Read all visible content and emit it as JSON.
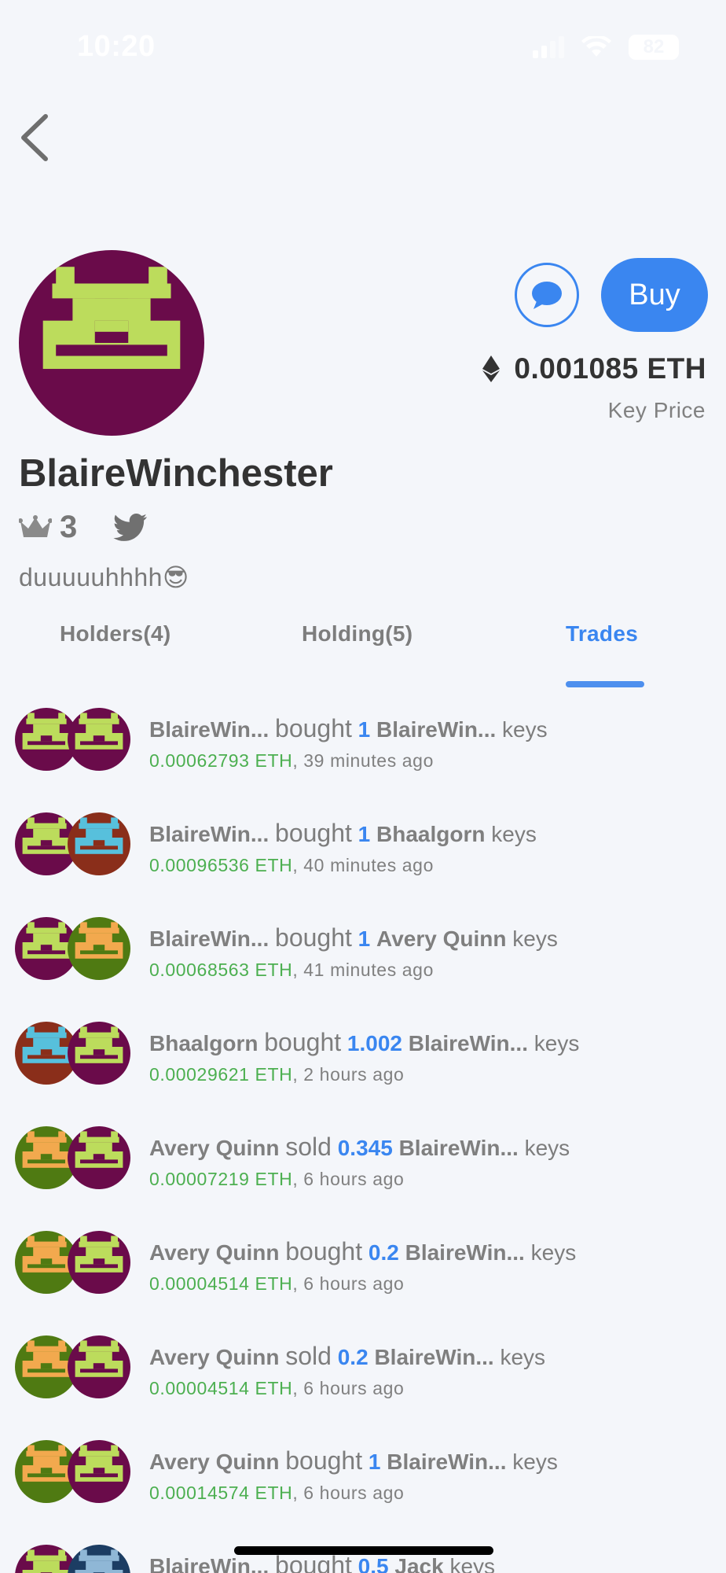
{
  "status": {
    "time": "10:20",
    "battery": "82"
  },
  "profile": {
    "name": "BlaireWinchester",
    "rank": "3",
    "bio": "duuuuuhhhh😎",
    "price": "0.001085 ETH",
    "price_caption": "Key Price",
    "buy_label": "Buy"
  },
  "tabs": [
    {
      "label": "Holders(4)"
    },
    {
      "label": "Holding(5)"
    },
    {
      "label": "Trades"
    }
  ],
  "trades": [
    {
      "trader": "BlaireWin...",
      "action": "bought",
      "amount": "1",
      "subject": "BlaireWin...",
      "unit": "keys",
      "eth": "0.00062793 ETH",
      "time": ", 39 minutes ago"
    },
    {
      "trader": "BlaireWin...",
      "action": "bought",
      "amount": "1",
      "subject": "Bhaalgorn",
      "unit": "keys",
      "eth": "0.00096536 ETH",
      "time": ", 40 minutes ago"
    },
    {
      "trader": "BlaireWin...",
      "action": "bought",
      "amount": "1",
      "subject": "Avery Quinn",
      "unit": "keys",
      "eth": "0.00068563 ETH",
      "time": ", 41 minutes ago"
    },
    {
      "trader": "Bhaalgorn",
      "action": "bought",
      "amount": "1.002",
      "subject": "BlaireWin...",
      "unit": "keys",
      "eth": "0.00029621 ETH",
      "time": ", 2 hours ago"
    },
    {
      "trader": "Avery Quinn",
      "action": "sold",
      "amount": "0.345",
      "subject": "BlaireWin...",
      "unit": "keys",
      "eth": "0.00007219 ETH",
      "time": ", 6 hours ago"
    },
    {
      "trader": "Avery Quinn",
      "action": "bought",
      "amount": "0.2",
      "subject": "BlaireWin...",
      "unit": "keys",
      "eth": "0.00004514 ETH",
      "time": ", 6 hours ago"
    },
    {
      "trader": "Avery Quinn",
      "action": "sold",
      "amount": "0.2",
      "subject": "BlaireWin...",
      "unit": "keys",
      "eth": "0.00004514 ETH",
      "time": ", 6 hours ago"
    },
    {
      "trader": "Avery Quinn",
      "action": "bought",
      "amount": "1",
      "subject": "BlaireWin...",
      "unit": "keys",
      "eth": "0.00014574 ETH",
      "time": ", 6 hours ago"
    },
    {
      "trader": "BlaireWin...",
      "action": "bought",
      "amount": "0.5",
      "subject": "Jack",
      "unit": "keys",
      "eth": "",
      "time": ""
    }
  ],
  "colors": {
    "accent": "#3a86f0",
    "eth_green": "#4caf50",
    "blaire_bg": "#6a0b4a",
    "blaire_fg": "#bcdc5c",
    "bhaal_bg": "#8a2e1a",
    "bhaal_fg": "#57c0dc",
    "avery_bg": "#4f7a12",
    "avery_fg": "#f2a94e",
    "jack_bg": "#1c3d63",
    "jack_fg": "#8fb7d6"
  },
  "icons": [
    "back-chevron-icon",
    "chat-bubble-icon",
    "ethereum-icon",
    "crown-icon",
    "twitter-icon",
    "signal-icon",
    "wifi-icon"
  ]
}
